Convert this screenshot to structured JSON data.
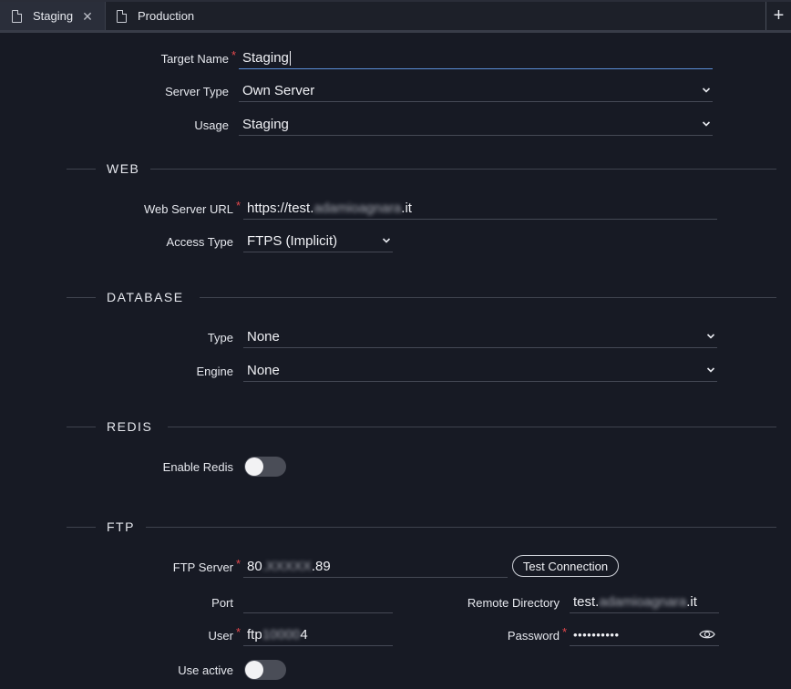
{
  "tabs": [
    {
      "label": "Staging",
      "active": true
    },
    {
      "label": "Production",
      "active": false
    }
  ],
  "general": {
    "target_name_label": "Target Name",
    "target_name_value": "Staging",
    "server_type_label": "Server Type",
    "server_type_value": "Own Server",
    "usage_label": "Usage",
    "usage_value": "Staging"
  },
  "web": {
    "title": "WEB",
    "url_label": "Web Server URL",
    "url_prefix": "https://test.",
    "url_masked": "adamioagnara",
    "url_suffix": ".it",
    "access_label": "Access Type",
    "access_value": "FTPS (Implicit)"
  },
  "database": {
    "title": "DATABASE",
    "type_label": "Type",
    "type_value": "None",
    "engine_label": "Engine",
    "engine_value": "None"
  },
  "redis": {
    "title": "REDIS",
    "enable_label": "Enable Redis",
    "enabled": false
  },
  "ftp": {
    "title": "FTP",
    "server_label": "FTP Server",
    "server_prefix": "80",
    "server_masked": ".XXXXX",
    "server_suffix": ".89",
    "test_button": "Test Connection",
    "port_label": "Port",
    "port_value": "",
    "remote_dir_label": "Remote Directory",
    "remote_prefix": "test.",
    "remote_masked": "adamioagnara",
    "remote_suffix": ".it",
    "user_label": "User",
    "user_prefix": "ftp",
    "user_masked": "10000",
    "user_suffix": "4",
    "password_label": "Password",
    "password_value": "••••••••••",
    "use_active_label": "Use active",
    "use_active": false
  },
  "colors": {
    "background": "#171a24",
    "required": "#e5484d",
    "focus_underline": "#5b8fd8"
  }
}
